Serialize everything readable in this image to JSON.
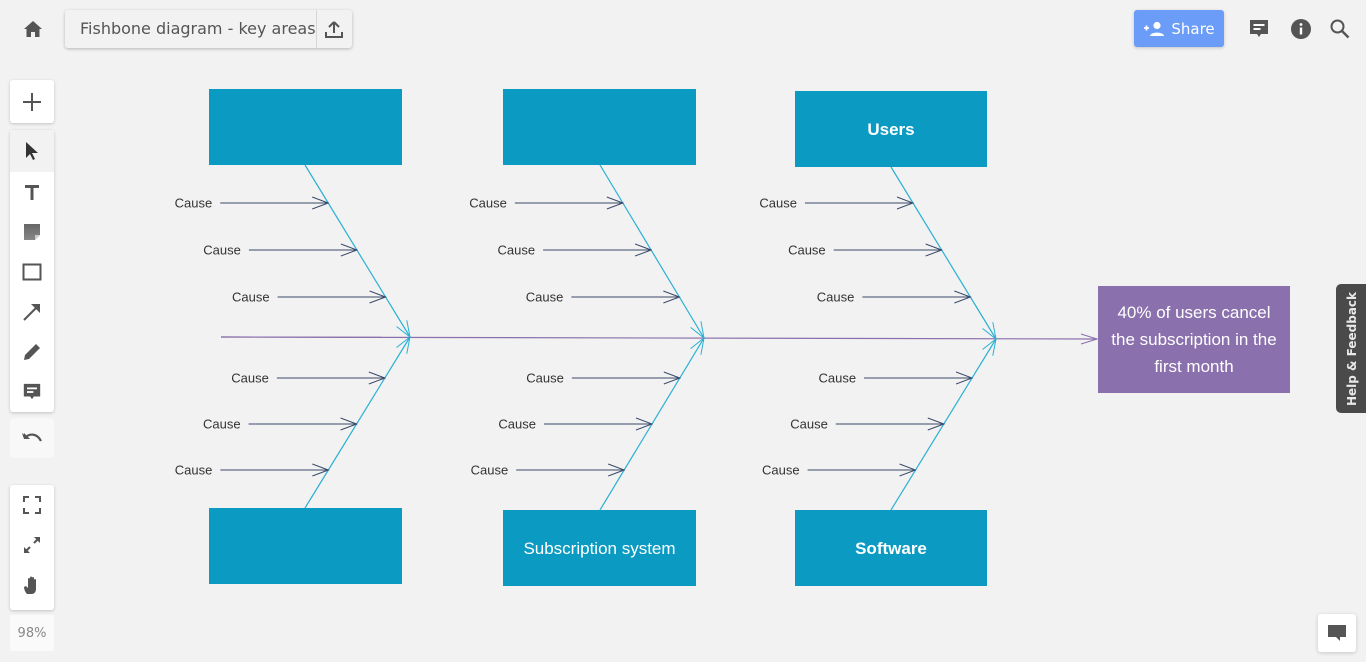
{
  "header": {
    "home_icon": "home-icon",
    "document_title": "Fishbone diagram - key areas",
    "export_icon": "upload-icon",
    "share_label": "Share",
    "share_icon": "add-person-icon",
    "comments_icon": "comment-icon",
    "info_icon": "info-icon",
    "search_icon": "search-icon"
  },
  "toolbar": {
    "add_icon": "plus-icon",
    "tools": [
      {
        "name": "select",
        "icon": "cursor-icon",
        "active": true
      },
      {
        "name": "text",
        "icon": "text-icon"
      },
      {
        "name": "sticky-note",
        "icon": "sticky-note-icon"
      },
      {
        "name": "shape",
        "icon": "rectangle-icon"
      },
      {
        "name": "line",
        "icon": "arrow-icon"
      },
      {
        "name": "pen",
        "icon": "pencil-icon"
      },
      {
        "name": "comment",
        "icon": "comment-icon"
      }
    ],
    "undo_icon": "undo-icon",
    "view_tools": [
      {
        "name": "fit-to-screen",
        "icon": "fit-screen-icon"
      },
      {
        "name": "fullscreen",
        "icon": "expand-icon"
      },
      {
        "name": "pan",
        "icon": "hand-icon"
      }
    ],
    "zoom_level": "98%"
  },
  "help_tab_label": "Help & Feedback",
  "chat_icon": "chat-icon",
  "colors": {
    "category_box": "#0b9bc2",
    "effect_box": "#8a70ac",
    "bone_line": "#2ab0d4",
    "spine_line": "#8a70ac",
    "cause_arrow": "#3b4a6b",
    "share_button": "#6b9cf8"
  },
  "diagram": {
    "effect": {
      "lines": [
        "40% of users cancel",
        "the subscription in the",
        "first month"
      ]
    },
    "categories": [
      {
        "position": "top-1",
        "label": "",
        "bold": false,
        "causes": [
          "Cause",
          "Cause",
          "Cause"
        ]
      },
      {
        "position": "top-2",
        "label": "",
        "bold": false,
        "causes": [
          "Cause",
          "Cause",
          "Cause"
        ]
      },
      {
        "position": "top-3",
        "label": "Users",
        "bold": true,
        "causes": [
          "Cause",
          "Cause",
          "Cause"
        ]
      },
      {
        "position": "bottom-1",
        "label": "",
        "bold": false,
        "causes": [
          "Cause",
          "Cause",
          "Cause"
        ]
      },
      {
        "position": "bottom-2",
        "label": "Subscription system",
        "bold": false,
        "causes": [
          "Cause",
          "Cause",
          "Cause"
        ]
      },
      {
        "position": "bottom-3",
        "label": "Software",
        "bold": true,
        "causes": [
          "Cause",
          "Cause",
          "Cause"
        ]
      }
    ]
  }
}
